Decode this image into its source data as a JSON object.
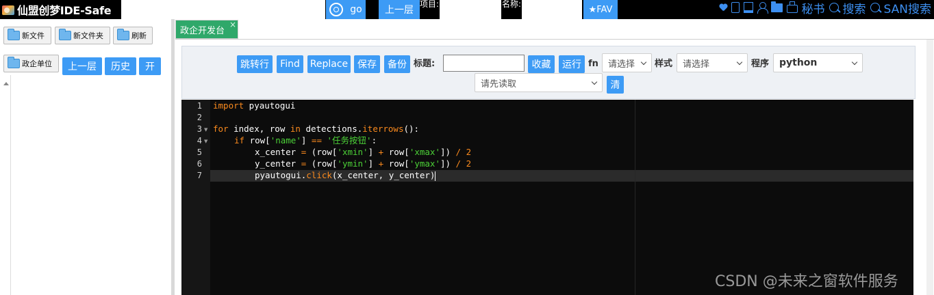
{
  "header": {
    "app_title": "仙盟创梦IDE-Safe",
    "search_value": "",
    "go_label": "go",
    "up_label": "上一层",
    "project_label": "项目:",
    "project_value": "",
    "name_label": "名称:",
    "name_value": "",
    "fav_label": "★FAV",
    "right_items": {
      "secret_label": "秘书",
      "search_label": "搜索",
      "san_search_label": "SAN搜索"
    }
  },
  "sidebar": {
    "new_file_label": "新文件",
    "new_folder_label": "新文件夹",
    "refresh_label": "刷新",
    "unit_label": "政企单位",
    "up_label": "上一层",
    "history_label": "历史",
    "open_label": "开"
  },
  "tabs": [
    {
      "label": "政企开发台",
      "active": true
    }
  ],
  "toolbar": {
    "goto_label": "跳转行",
    "find_label": "Find",
    "replace_label": "Replace",
    "save_label": "保存",
    "backup_label": "备份",
    "title_label": "标题:",
    "title_value": "",
    "collect_label": "收藏",
    "run_label": "运行",
    "fn_label": "fn",
    "fn_select": "请选择",
    "style_label": "样式",
    "style_select": "请选择",
    "program_label": "程序",
    "program_select": "python",
    "read_select": "请先读取",
    "clear_label": "清"
  },
  "editor": {
    "line_numbers": [
      "1",
      "2",
      "3",
      "4",
      "5",
      "6",
      "7"
    ],
    "code": {
      "l1_kw": "import",
      "l1_rest": " pyautogui",
      "l3_for": "for",
      "l3_a": " index, row ",
      "l3_in": "in",
      "l3_b": " detections.",
      "l3_fn": "iterrows",
      "l3_c": "():",
      "l4_if": "if",
      "l4_a": " row[",
      "l4_s1": "'name'",
      "l4_b": "] ",
      "l4_op": "==",
      "l4_c": " ",
      "l4_s2": "'任务按钮'",
      "l4_d": ":",
      "l5_a": "x_center ",
      "l5_eq": "=",
      "l5_b": " (row[",
      "l5_s1": "'xmin'",
      "l5_c": "] ",
      "l5_plus": "+",
      "l5_d": " row[",
      "l5_s2": "'xmax'",
      "l5_e": "]) ",
      "l5_div": "/",
      "l5_f": " ",
      "l5_num": "2",
      "l6_a": "y_center ",
      "l6_eq": "=",
      "l6_b": " (row[",
      "l6_s1": "'ymin'",
      "l6_c": "] ",
      "l6_plus": "+",
      "l6_d": " row[",
      "l6_s2": "'ymax'",
      "l6_e": "]) ",
      "l6_div": "/",
      "l6_f": " ",
      "l6_num": "2",
      "l7_a": "pyautogui.",
      "l7_fn": "click",
      "l7_b": "(x_center, y_center)"
    },
    "active_line": 7
  },
  "watermark": "CSDN @未来之窗软件服务",
  "colors": {
    "accent": "#3d9bf5",
    "tab_active": "#2fa86a",
    "keyword": "#fa8a1e",
    "string": "#4cd137"
  }
}
